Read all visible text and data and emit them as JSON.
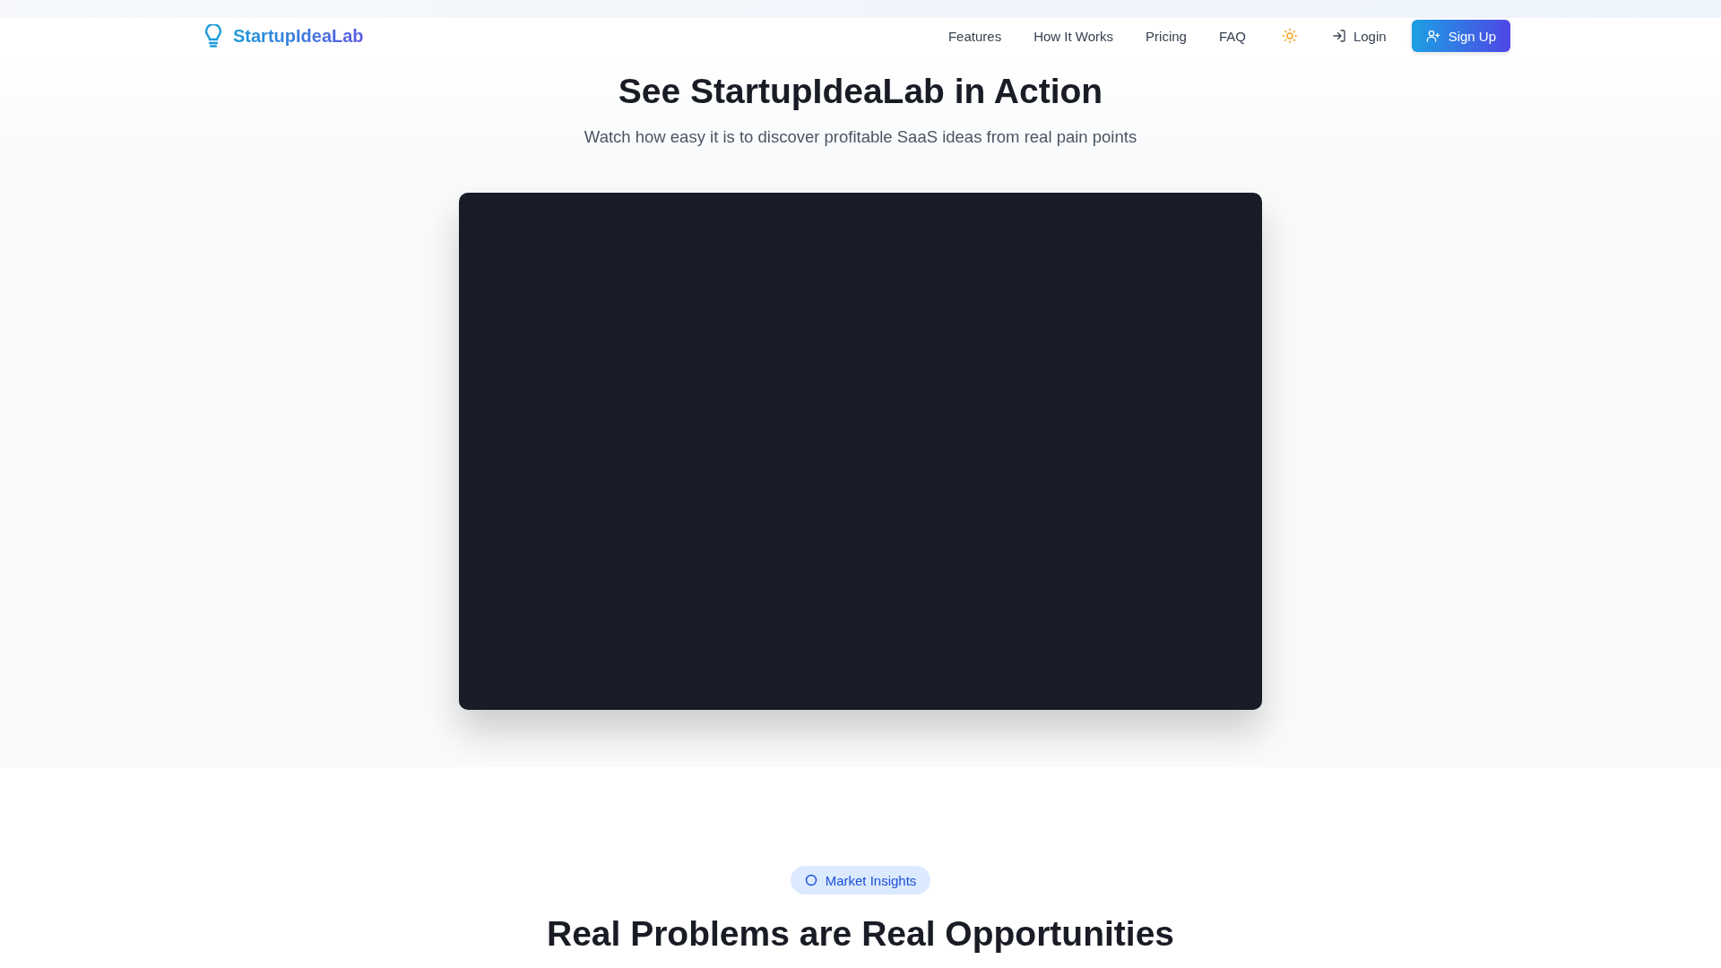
{
  "header": {
    "logo": "StartupIdeaLab",
    "nav": [
      {
        "label": "Features"
      },
      {
        "label": "How It Works"
      },
      {
        "label": "Pricing"
      },
      {
        "label": "FAQ"
      }
    ],
    "dark_mode": false,
    "login": "Login",
    "signup": "Sign Up"
  },
  "demo": {
    "title": "See StartupIdeaLab in Action",
    "subtitle": "Watch how easy it is to discover profitable SaaS ideas from real pain points",
    "video": {
      "kind": "empty"
    }
  },
  "insights": {
    "badge": "Market Insights",
    "title": "Real Problems are Real Opportunities"
  }
}
